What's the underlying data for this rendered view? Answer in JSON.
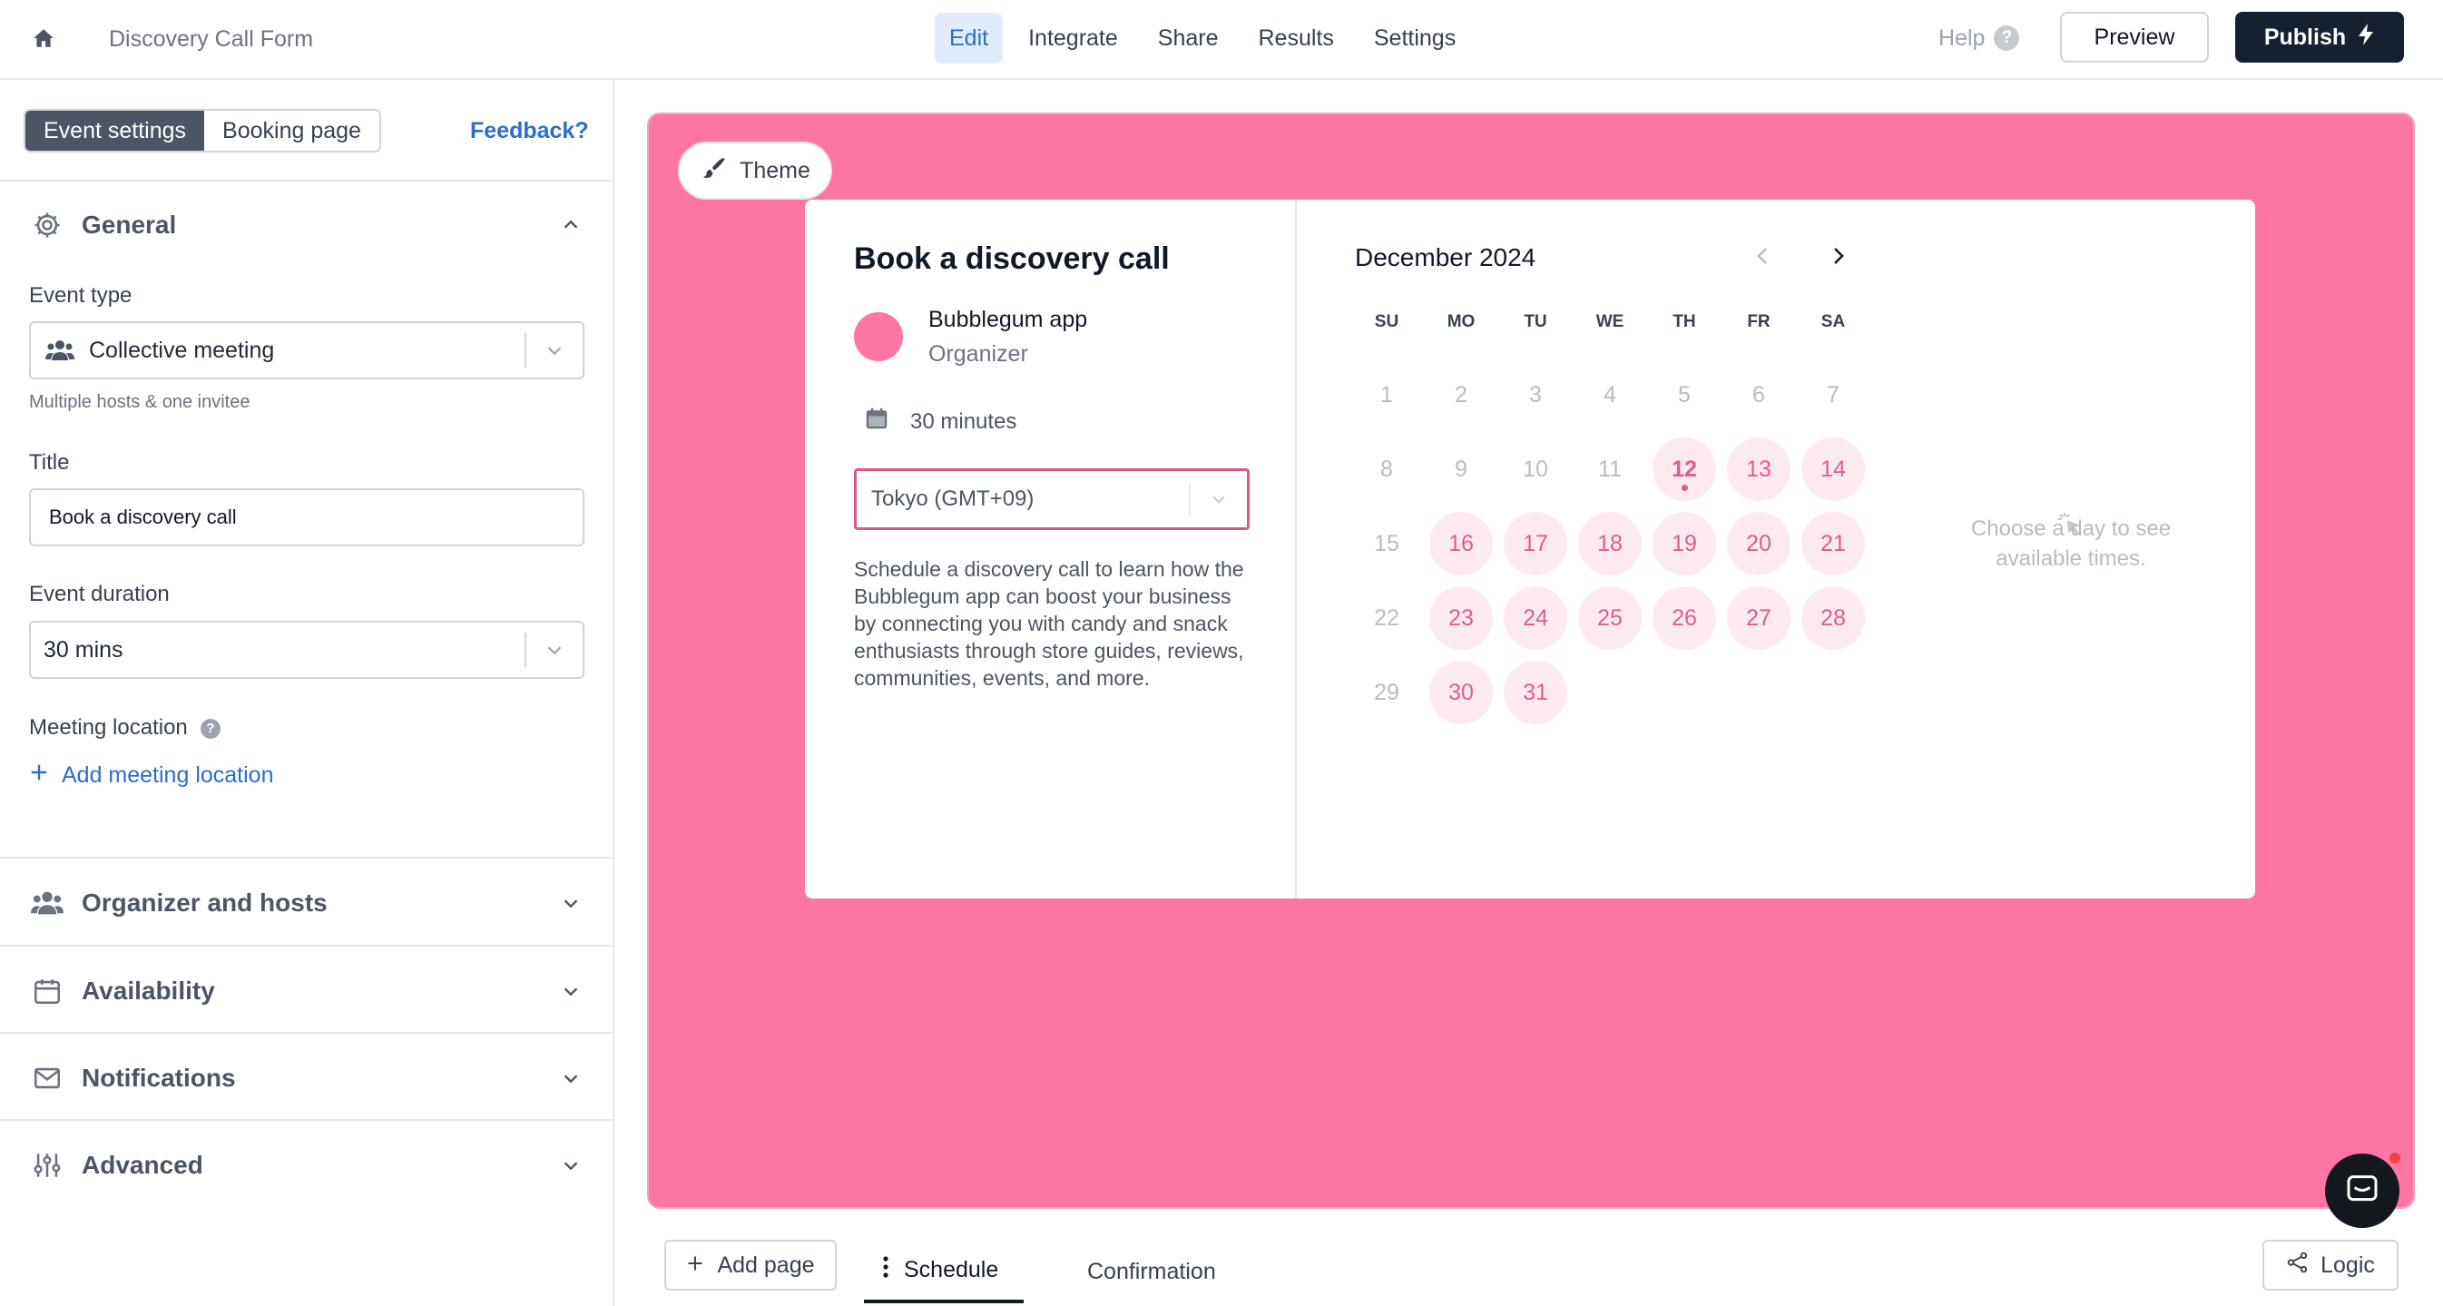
{
  "topbar": {
    "form_name": "Discovery Call Form",
    "nav": [
      "Edit",
      "Integrate",
      "Share",
      "Results",
      "Settings"
    ],
    "active_nav": "Edit",
    "help_label": "Help",
    "help_badge": "?",
    "preview_label": "Preview",
    "publish_label": "Publish"
  },
  "sidebar": {
    "tabs": [
      "Event settings",
      "Booking page"
    ],
    "feedback_label": "Feedback?",
    "general": {
      "title": "General",
      "event_type_label": "Event type",
      "event_type_value": "Collective meeting",
      "event_type_hint": "Multiple hosts & one invitee",
      "title_label": "Title",
      "title_value": "Book a discovery call",
      "duration_label": "Event duration",
      "duration_value": "30 mins",
      "location_label": "Meeting location",
      "location_info": "?",
      "add_location_label": "Add meeting location"
    },
    "sections": [
      "Organizer and hosts",
      "Availability",
      "Notifications",
      "Advanced"
    ]
  },
  "canvas": {
    "theme_label": "Theme",
    "background_color": "#ff76a5",
    "event": {
      "title": "Book a discovery call",
      "organizer_name": "Bubblegum app",
      "organizer_role": "Organizer",
      "duration": "30 minutes",
      "timezone": "Tokyo (GMT+09)",
      "description": "Schedule a discovery call to learn how the Bubblegum app can boost your business by connecting you with candy and snack enthusiasts through store guides, reviews, communities, events, and more."
    },
    "calendar": {
      "month": "December 2024",
      "weekdays": [
        "SU",
        "MO",
        "TU",
        "WE",
        "TH",
        "FR",
        "SA"
      ],
      "today": "12",
      "days": [
        [
          "1",
          "2",
          "3",
          "4",
          "5",
          "6",
          "7"
        ],
        [
          "8",
          "9",
          "10",
          "11",
          "12",
          "13",
          "14"
        ],
        [
          "15",
          "16",
          "17",
          "18",
          "19",
          "20",
          "21"
        ],
        [
          "22",
          "23",
          "24",
          "25",
          "26",
          "27",
          "28"
        ],
        [
          "29",
          "30",
          "31"
        ]
      ],
      "available": [
        "12",
        "13",
        "14",
        "16",
        "17",
        "18",
        "19",
        "20",
        "21",
        "23",
        "24",
        "25",
        "26",
        "27",
        "28",
        "30",
        "31"
      ],
      "empty_hint": "Choose a day to see available times."
    }
  },
  "bottom": {
    "add_page_label": "Add page",
    "pages": [
      "Schedule",
      "Confirmation"
    ],
    "active_page": "Schedule",
    "logic_label": "Logic"
  },
  "icons": {
    "home": "home-icon",
    "bolt": "bolt-icon",
    "gear": "gear-icon",
    "people": "people-icon",
    "calendar": "calendar-icon",
    "mail": "mail-icon",
    "sliders": "sliders-icon",
    "chevron": "chevron-icon",
    "brush": "paint-brush-icon",
    "chat": "chat-icon",
    "share": "share-icon",
    "plus": "plus-icon",
    "kebab": "vertical-dots-icon",
    "pointer": "pointer-click-icon"
  },
  "colors": {
    "accent_blue": "#2a6fc9",
    "publish_bg": "#17202e",
    "pink": "#ff76a5",
    "pink_text": "#e05b8e",
    "pink_light": "#fdeaf1"
  }
}
